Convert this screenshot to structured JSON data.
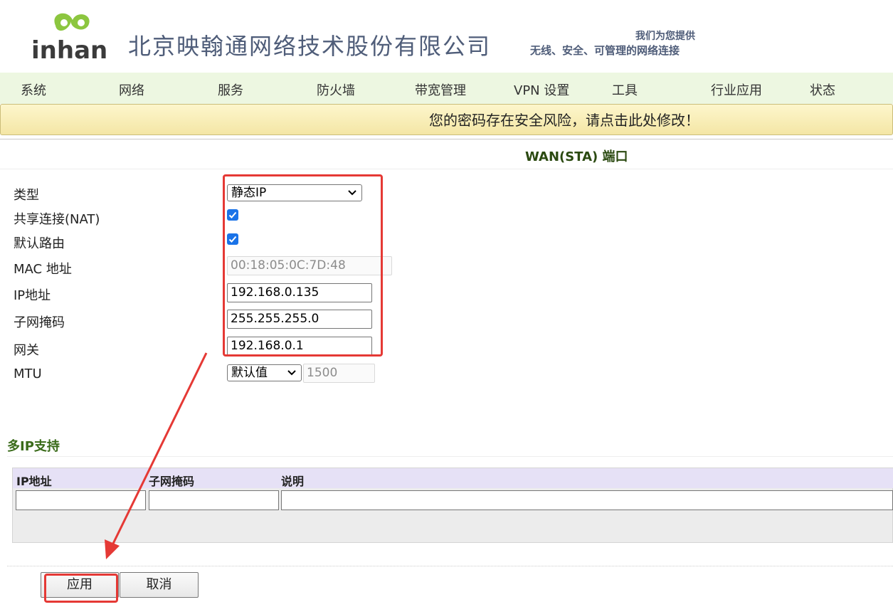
{
  "header": {
    "logo_text": "inhand",
    "company_name": "北京映翰通网络技术股份有限公司",
    "slogan_line1": "我们为您提供",
    "slogan_line2": "无线、安全、可管理的网络连接"
  },
  "nav": {
    "items": [
      {
        "label": "系统"
      },
      {
        "label": "网络"
      },
      {
        "label": "服务"
      },
      {
        "label": "防火墙"
      },
      {
        "label": "带宽管理"
      },
      {
        "label": "VPN 设置"
      },
      {
        "label": "工具"
      },
      {
        "label": "行业应用"
      },
      {
        "label": "状态"
      }
    ]
  },
  "warning": {
    "text": "您的密码存在安全风险，请点击此处修改！"
  },
  "form": {
    "title": "WAN(STA) 端口",
    "type": {
      "label": "类型",
      "value": "静态IP"
    },
    "nat": {
      "label": "共享连接(NAT)",
      "checked": true
    },
    "default_route": {
      "label": "默认路由",
      "checked": true
    },
    "mac": {
      "label": "MAC 地址",
      "value": "00:18:05:0C:7D:48"
    },
    "ip": {
      "label": "IP地址",
      "value": "192.168.0.135"
    },
    "netmask": {
      "label": "子网掩码",
      "value": "255.255.255.0"
    },
    "gateway": {
      "label": "网关",
      "value": "192.168.0.1"
    },
    "mtu": {
      "label": "MTU",
      "mode": "默认值",
      "value": "1500"
    }
  },
  "multi_ip": {
    "title": "多IP支持",
    "columns": [
      "IP地址",
      "子网掩码",
      "说明"
    ],
    "row": [
      "",
      "",
      ""
    ]
  },
  "actions": {
    "apply": "应用",
    "cancel": "取消"
  },
  "colors": {
    "annotation_red": "#e53935",
    "nav_bg": "#edf7e1",
    "warning_bg": "#fdf6cc",
    "table_header_bg": "#e6e1f6"
  }
}
